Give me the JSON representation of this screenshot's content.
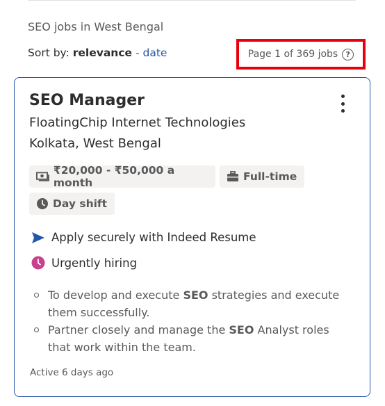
{
  "header": {
    "context_text": "SEO jobs in West Bengal",
    "sort_label": "Sort by:",
    "sort_active": "relevance",
    "sort_separator": " - ",
    "sort_alt": "date",
    "page_count": "Page 1 of 369 jobs",
    "help_glyph": "?"
  },
  "job": {
    "title": "SEO Manager",
    "company": "FloatingChip Internet Technologies",
    "location": "Kolkata, West Bengal",
    "salary": "₹20,000 - ₹50,000 a month",
    "job_type": "Full-time",
    "shift": "Day shift",
    "apply_text": "Apply securely with Indeed Resume",
    "urgent_text": "Urgently hiring",
    "snippets": [
      {
        "before": "To develop and execute ",
        "bold": "SEO",
        "after": " strategies and execute them successfully."
      },
      {
        "before": "Partner closely and manage the ",
        "bold": "SEO",
        "after": " Analyst roles that work within the team."
      }
    ],
    "active": "Active 6 days ago"
  },
  "icons": {
    "salary": "money-icon",
    "job_type": "briefcase-icon",
    "shift": "clock-icon",
    "apply": "send-arrow-icon",
    "urgent": "urgent-clock-icon",
    "menu": "kebab-menu-icon",
    "help": "help-circle-icon"
  },
  "colors": {
    "link": "#2557a7",
    "card_border": "#2557a7",
    "highlight_box": "#e8000b",
    "urgent": "#c7418f",
    "tag_bg": "#f3f2f1"
  }
}
